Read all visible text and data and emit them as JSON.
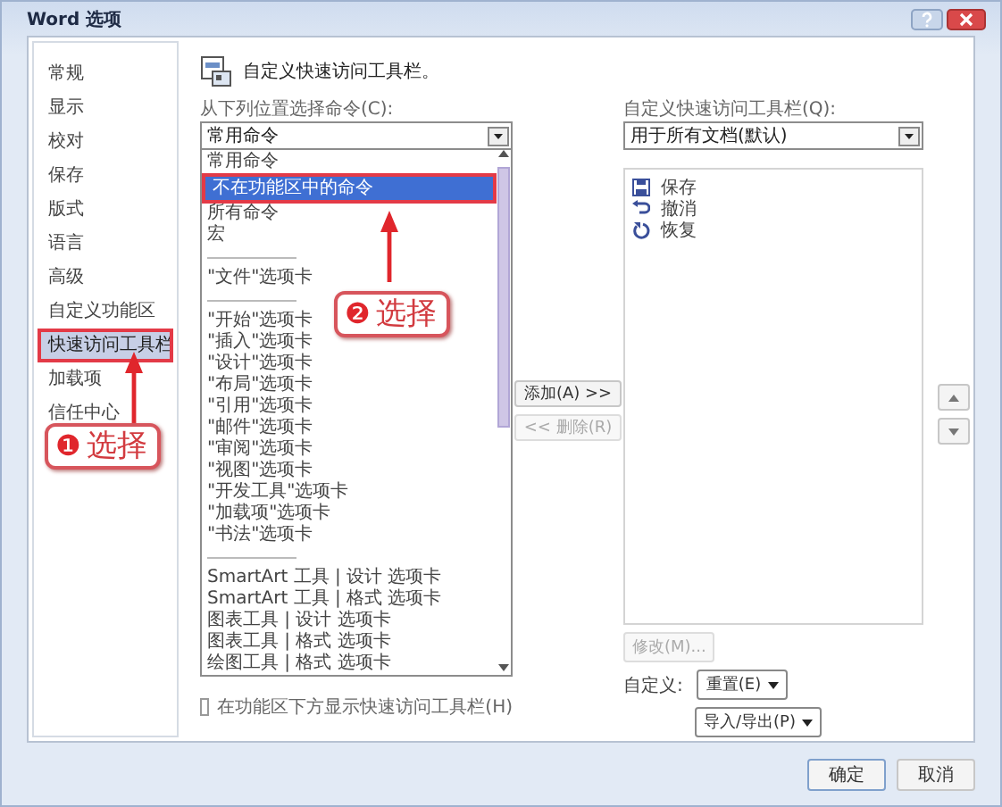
{
  "window": {
    "title": "Word 选项"
  },
  "sidebar": {
    "items": [
      {
        "label": "常规",
        "selected": false
      },
      {
        "label": "显示",
        "selected": false
      },
      {
        "label": "校对",
        "selected": false
      },
      {
        "label": "保存",
        "selected": false
      },
      {
        "label": "版式",
        "selected": false
      },
      {
        "label": "语言",
        "selected": false
      },
      {
        "label": "高级",
        "selected": false
      },
      {
        "label": "自定义功能区",
        "selected": false
      },
      {
        "label": "快速访问工具栏",
        "selected": true
      },
      {
        "label": "加载项",
        "selected": false
      },
      {
        "label": "信任中心",
        "selected": false
      }
    ]
  },
  "heading": "自定义快速访问工具栏。",
  "commands": {
    "label": "从下列位置选择命令(C):",
    "dropdown": "常用命令",
    "items": [
      {
        "kind": "item",
        "label": "常用命令",
        "selected": false
      },
      {
        "kind": "item",
        "label": "不在功能区中的命令",
        "selected": true
      },
      {
        "kind": "item",
        "label": "所有命令",
        "selected": false
      },
      {
        "kind": "item",
        "label": "宏",
        "selected": false
      },
      {
        "kind": "separator"
      },
      {
        "kind": "item",
        "label": "\"文件\"选项卡",
        "selected": false
      },
      {
        "kind": "separator"
      },
      {
        "kind": "item",
        "label": "\"开始\"选项卡",
        "selected": false
      },
      {
        "kind": "item",
        "label": "\"插入\"选项卡",
        "selected": false
      },
      {
        "kind": "item",
        "label": "\"设计\"选项卡",
        "selected": false
      },
      {
        "kind": "item",
        "label": "\"布局\"选项卡",
        "selected": false
      },
      {
        "kind": "item",
        "label": "\"引用\"选项卡",
        "selected": false
      },
      {
        "kind": "item",
        "label": "\"邮件\"选项卡",
        "selected": false
      },
      {
        "kind": "item",
        "label": "\"审阅\"选项卡",
        "selected": false
      },
      {
        "kind": "item",
        "label": "\"视图\"选项卡",
        "selected": false
      },
      {
        "kind": "item",
        "label": "\"开发工具\"选项卡",
        "selected": false
      },
      {
        "kind": "item",
        "label": "\"加载项\"选项卡",
        "selected": false
      },
      {
        "kind": "item",
        "label": "\"书法\"选项卡",
        "selected": false
      },
      {
        "kind": "separator"
      },
      {
        "kind": "item",
        "label": "SmartArt 工具 | 设计 选项卡",
        "selected": false
      },
      {
        "kind": "item",
        "label": "SmartArt 工具 | 格式 选项卡",
        "selected": false
      },
      {
        "kind": "item",
        "label": "图表工具 | 设计 选项卡",
        "selected": false
      },
      {
        "kind": "item",
        "label": "图表工具 | 格式 选项卡",
        "selected": false
      },
      {
        "kind": "item",
        "label": "绘图工具 | 格式 选项卡",
        "selected": false
      }
    ]
  },
  "toolbar": {
    "label": "自定义快速访问工具栏(Q):",
    "dropdown": "用于所有文档(默认)",
    "items": [
      {
        "kind": "save",
        "label": "保存"
      },
      {
        "kind": "undo",
        "label": "撤消"
      },
      {
        "kind": "redo",
        "label": "恢复"
      }
    ]
  },
  "move_buttons": [
    {
      "label": "添加(A) >>",
      "disabled": false
    },
    {
      "label": "<< 删除(R)",
      "disabled": true
    }
  ],
  "show_below": {
    "label": "在功能区下方显示快速访问工具栏(H)",
    "checked": false
  },
  "modify_button": {
    "label": "修改(M)...",
    "disabled": true
  },
  "customize": {
    "label": "自定义:",
    "reset": "重置(E)",
    "import_export": "导入/导出(P)"
  },
  "dialog_buttons": [
    "确定",
    "取消"
  ],
  "callouts": [
    {
      "kind": "sidebar",
      "number": "❶",
      "text": "选择"
    },
    {
      "kind": "list",
      "number": "❷",
      "text": "选择"
    }
  ]
}
